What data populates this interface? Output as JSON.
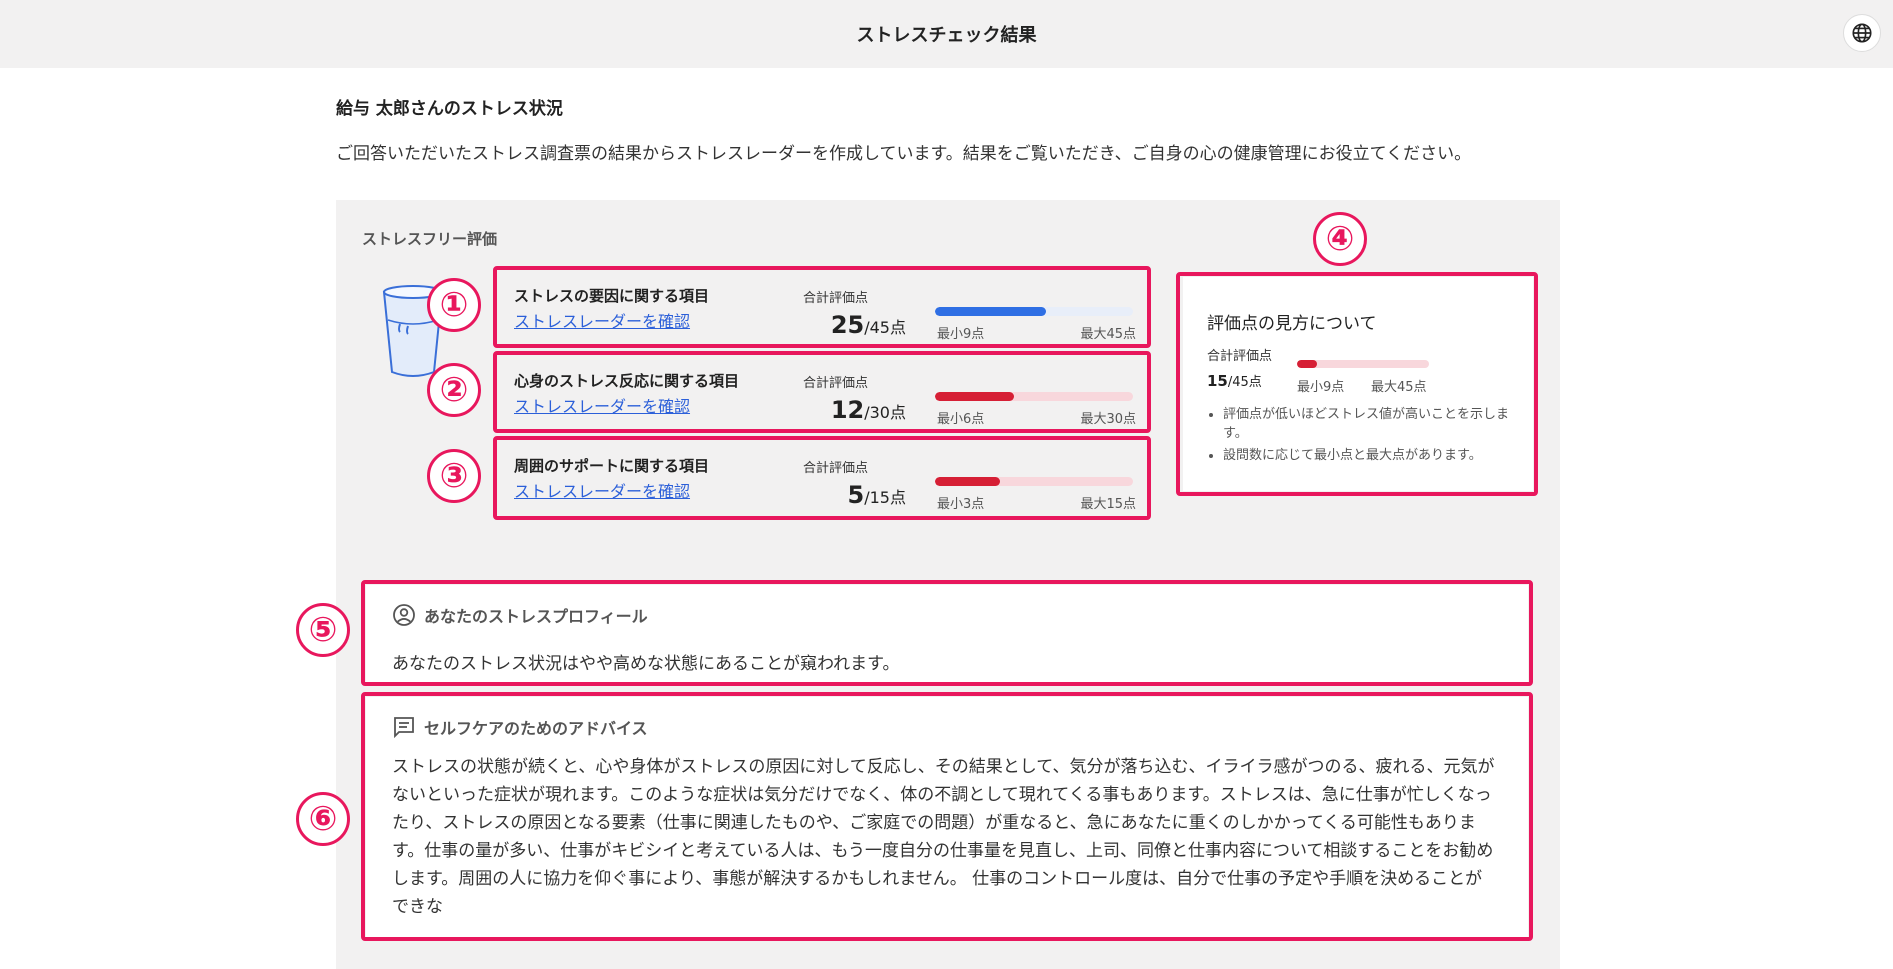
{
  "header": {
    "title": "ストレスチェック結果",
    "language_icon": "globe-icon"
  },
  "page": {
    "heading": "給与 太郎さんのストレス状況",
    "intro": "ご回答いただいたストレス調査票の結果からストレスレーダーを作成しています。結果をご覧いただき、ご自身の心の健康管理にお役立てください。"
  },
  "evaluation": {
    "title": "ストレスフリー評価",
    "items": [
      {
        "name": "ストレスの要因に関する項目",
        "link": "ストレスレーダーを確認",
        "sum_label": "合計評価点",
        "score": "25",
        "max_text": "/45点",
        "fraction": 0.56,
        "min_label": "最小9点",
        "max_label": "最大45点",
        "bar_color": "#2f6fe4"
      },
      {
        "name": "心身のストレス反応に関する項目",
        "link": "ストレスレーダーを確認",
        "sum_label": "合計評価点",
        "score": "12",
        "max_text": "/30点",
        "fraction": 0.4,
        "min_label": "最小6点",
        "max_label": "最大30点",
        "bar_color": "#d61f35"
      },
      {
        "name": "周囲のサポートに関する項目",
        "link": "ストレスレーダーを確認",
        "sum_label": "合計評価点",
        "score": "5",
        "max_text": "/15点",
        "fraction": 0.33,
        "min_label": "最小3点",
        "max_label": "最大15点",
        "bar_color": "#d61f35"
      }
    ]
  },
  "guide": {
    "title": "評価点の見方について",
    "sum_label": "合計評価点",
    "score": "15",
    "max_text": "/45点",
    "fraction": 0.15,
    "min_label": "最小9点",
    "max_label": "最大45点",
    "notes": [
      "評価点が低いほどストレス値が高いことを示します。",
      "設問数に応じて最小点と最大点があります。"
    ]
  },
  "profile": {
    "title": "あなたのストレスプロフィール",
    "icon": "user-circle-icon",
    "text": "あなたのストレス状況はやや高めな状態にあることが窺われます。"
  },
  "advice": {
    "title": "セルフケアのためのアドバイス",
    "icon": "message-icon",
    "text": "ストレスの状態が続くと、心や身体がストレスの原因に対して反応し、その結果として、気分が落ち込む、イライラ感がつのる、疲れる、元気がないといった症状が現れます。このような症状は気分だけでなく、体の不調として現れてくる事もあります。ストレスは、急に仕事が忙しくなったり、ストレスの原因となる要素（仕事に関連したものや、ご家庭での問題）が重なると、急にあなたに重くのしかかってくる可能性もあります。仕事の量が多い、仕事がキビシイと考えている人は、もう一度自分の仕事量を見直し、上司、同僚と仕事内容について相談することをお勧めします。周囲の人に協力を仰ぐ事により、事態が解決するかもしれません。 仕事のコントロール度は、自分で仕事の予定や手順を決めることができな"
  },
  "annotations": {
    "markers": [
      "①",
      "②",
      "③",
      "④",
      "⑤",
      "⑥"
    ],
    "color": "#e8175d"
  }
}
